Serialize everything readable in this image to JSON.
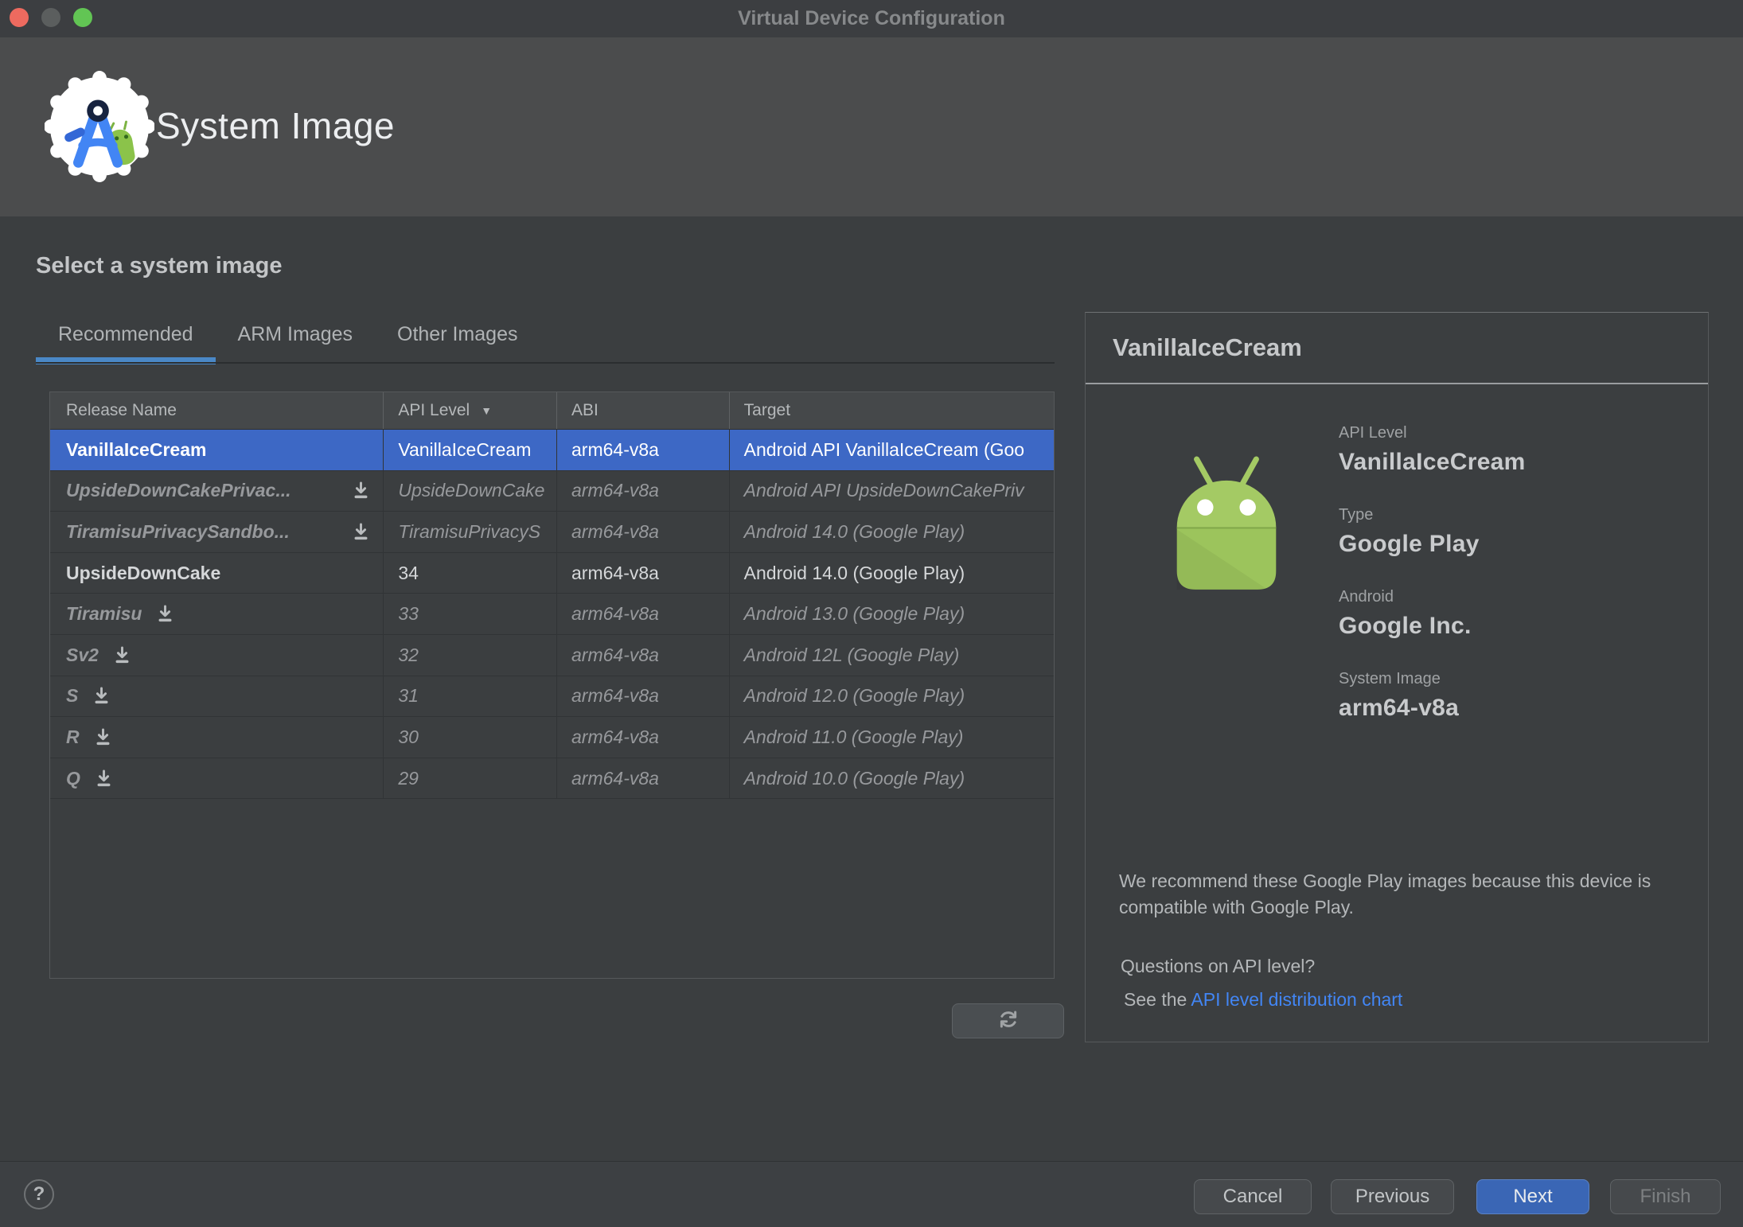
{
  "window": {
    "title": "Virtual Device Configuration"
  },
  "header": {
    "title": "System Image"
  },
  "content": {
    "heading": "Select a system image",
    "tabs": [
      {
        "label": "Recommended",
        "active": true
      },
      {
        "label": "ARM Images",
        "active": false
      },
      {
        "label": "Other Images",
        "active": false
      }
    ],
    "table": {
      "columns": [
        "Release Name",
        "API Level",
        "ABI",
        "Target"
      ],
      "sorted_column": "API Level",
      "rows": [
        {
          "release": "VanillaIceCream",
          "api": "VanillaIceCream",
          "abi": "arm64-v8a",
          "target": "Android API VanillaIceCream (Goo",
          "state": "selected",
          "download": false
        },
        {
          "release": "UpsideDownCakePrivac...",
          "api": "UpsideDownCake",
          "abi": "arm64-v8a",
          "target": "Android API UpsideDownCakePriv",
          "state": "available",
          "download": true
        },
        {
          "release": "TiramisuPrivacySandbo...",
          "api": "TiramisuPrivacyS",
          "abi": "arm64-v8a",
          "target": "Android 14.0 (Google Play)",
          "state": "available",
          "download": true
        },
        {
          "release": "UpsideDownCake",
          "api": "34",
          "abi": "arm64-v8a",
          "target": "Android 14.0 (Google Play)",
          "state": "installed",
          "download": false
        },
        {
          "release": "Tiramisu",
          "api": "33",
          "abi": "arm64-v8a",
          "target": "Android 13.0 (Google Play)",
          "state": "available",
          "download": true
        },
        {
          "release": "Sv2",
          "api": "32",
          "abi": "arm64-v8a",
          "target": "Android 12L (Google Play)",
          "state": "available",
          "download": true
        },
        {
          "release": "S",
          "api": "31",
          "abi": "arm64-v8a",
          "target": "Android 12.0 (Google Play)",
          "state": "available",
          "download": true
        },
        {
          "release": "R",
          "api": "30",
          "abi": "arm64-v8a",
          "target": "Android 11.0 (Google Play)",
          "state": "available",
          "download": true
        },
        {
          "release": "Q",
          "api": "29",
          "abi": "arm64-v8a",
          "target": "Android 10.0 (Google Play)",
          "state": "available",
          "download": true
        }
      ]
    }
  },
  "details": {
    "title": "VanillaIceCream",
    "fields": [
      {
        "label": "API Level",
        "value": "VanillaIceCream"
      },
      {
        "label": "Type",
        "value": "Google Play"
      },
      {
        "label": "Android",
        "value": "Google Inc."
      },
      {
        "label": "System Image",
        "value": "arm64-v8a"
      }
    ],
    "recommendation": "We recommend these Google Play images because this device is compatible with Google Play.",
    "question": "Questions on API level?",
    "see_prefix": "See the ",
    "link_label": "API level distribution chart"
  },
  "footer": {
    "help": "?",
    "cancel": "Cancel",
    "previous": "Previous",
    "next": "Next",
    "finish": "Finish"
  },
  "colors": {
    "selection_blue": "#3d68c5",
    "tab_underline": "#4a88c7",
    "link_blue": "#4286f5",
    "primary_button": "#3a66b5",
    "header_band": "#4b4c4d",
    "body_bg": "#3b3e40",
    "android_green": "#a4ca64"
  }
}
